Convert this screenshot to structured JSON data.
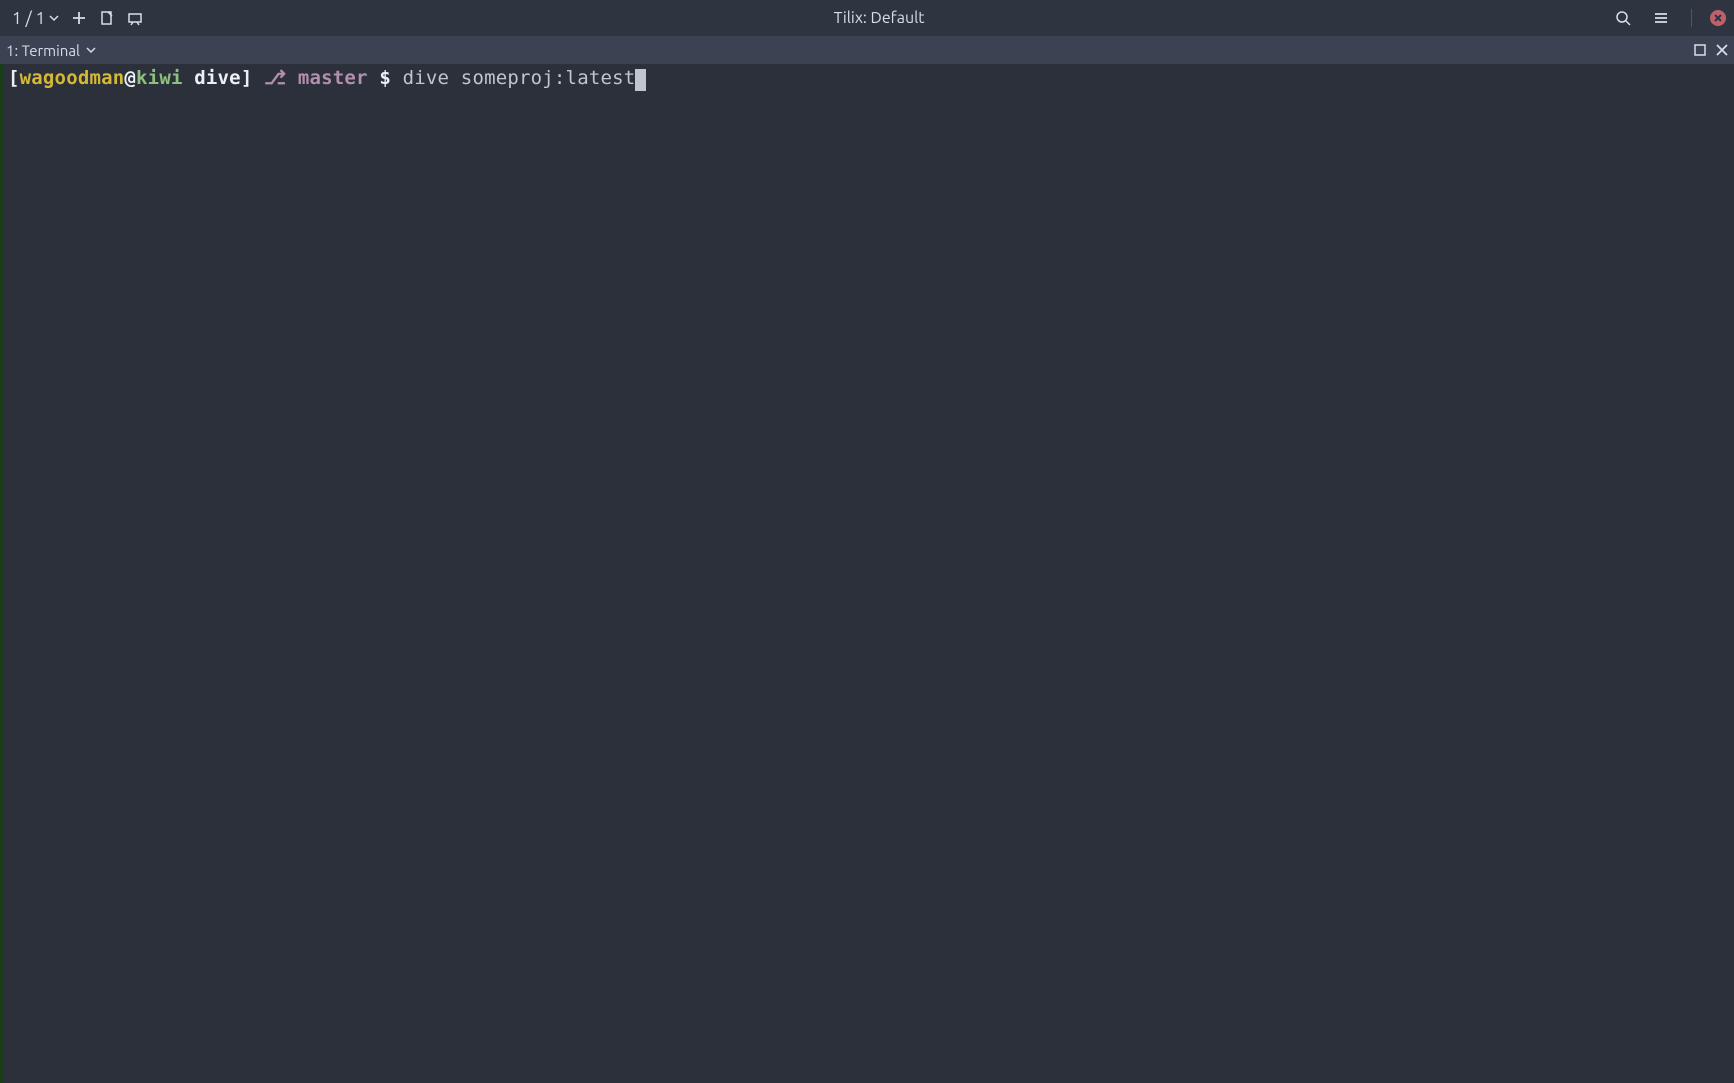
{
  "titlebar": {
    "session": "1 / 1",
    "title": "Tilix: Default"
  },
  "tab": {
    "label": "1: Terminal"
  },
  "prompt": {
    "bracket_open": "[",
    "user": "wagoodman",
    "at": "@",
    "host": "kiwi",
    "space1": " ",
    "folder": "dive",
    "bracket_close": "]",
    "branch_icon": "⎇",
    "branch": "master",
    "dollar": "$",
    "command": "dive someproj:latest"
  }
}
